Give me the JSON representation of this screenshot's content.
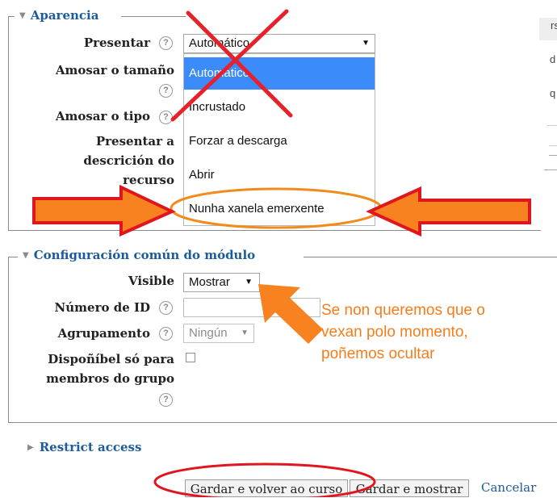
{
  "appearance": {
    "legend": "Aparencia",
    "presentar": {
      "label": "Presentar",
      "value": "Automático"
    },
    "amosar_tamano": {
      "label": "Amosar o tamaño"
    },
    "amosar_tipo": {
      "label": "Amosar o tipo"
    },
    "presentar_descricion": {
      "label_lines": [
        "Presentar a",
        "descrición do",
        "recurso"
      ]
    },
    "dropdown_options": [
      "Automático",
      "Incrustado",
      "Forzar a descarga",
      "Abrir",
      "Nunha xanela emerxente"
    ],
    "selected_index": 0
  },
  "common": {
    "legend": "Configuración común do módulo",
    "visible": {
      "label": "Visible",
      "value": "Mostrar"
    },
    "id_number": {
      "label": "Número de ID",
      "value": ""
    },
    "grouping": {
      "label": "Agrupamento",
      "value": "Ningún"
    },
    "group_members": {
      "label_lines": [
        "Dispoñíbel só para",
        "membros do grupo"
      ],
      "checked": false
    }
  },
  "restrict": {
    "label": "Restrict access"
  },
  "buttons": {
    "save_return": "Gardar e volver ao curso",
    "save_show": "Gardar e mostrar",
    "cancel": "Cancelar"
  },
  "annotation": {
    "lines": [
      "Se non queremos que o",
      "vexan polo momento,",
      "poñemos ocultar"
    ],
    "color": "#f77c1b"
  },
  "right_edge": {
    "snippets": [
      "rs",
      "d",
      "q"
    ]
  },
  "icons": {
    "help": "?",
    "caret": "▼",
    "legend_expanded": "▼",
    "legend_collapsed": "▶"
  }
}
